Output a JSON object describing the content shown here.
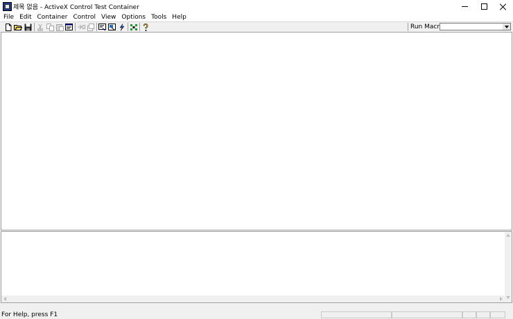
{
  "window": {
    "title": "제목 없음 - ActiveX Control Test Container"
  },
  "menu": {
    "items": [
      {
        "label": "File"
      },
      {
        "label": "Edit"
      },
      {
        "label": "Container"
      },
      {
        "label": "Control"
      },
      {
        "label": "View"
      },
      {
        "label": "Options"
      },
      {
        "label": "Tools"
      },
      {
        "label": "Help"
      }
    ]
  },
  "toolbar": {
    "buttons": [
      {
        "icon": "new-document-icon"
      },
      {
        "icon": "open-folder-icon"
      },
      {
        "icon": "save-icon"
      },
      {
        "icon": "cut-icon"
      },
      {
        "icon": "copy-icon"
      },
      {
        "icon": "paste-icon"
      },
      {
        "icon": "properties-icon"
      },
      {
        "icon": "insert-control-icon"
      },
      {
        "icon": "delete-control-icon"
      },
      {
        "icon": "invoke-methods-icon"
      },
      {
        "icon": "control-properties-icon"
      },
      {
        "icon": "events-icon"
      },
      {
        "icon": "design-mode-icon"
      },
      {
        "icon": "help-icon"
      }
    ],
    "run_macro_label": "Run Macro:",
    "run_macro_value": ""
  },
  "status": {
    "text": "For Help, press F1"
  },
  "colors": {
    "accent": "#1d3a8a",
    "background": "#f0f0f0",
    "pane": "#ffffff"
  }
}
